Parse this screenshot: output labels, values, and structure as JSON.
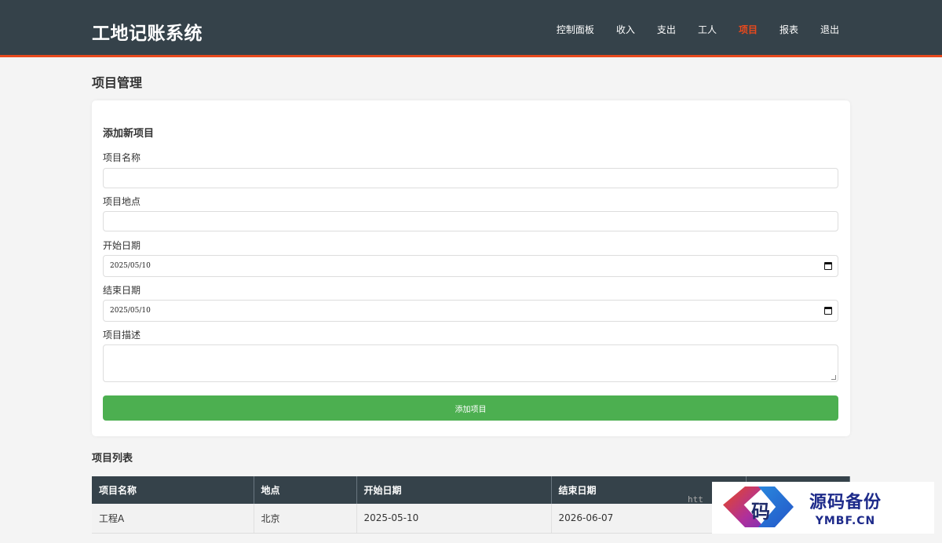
{
  "header": {
    "brand": "工地记账系统",
    "nav": [
      {
        "label": "控制面板",
        "active": false
      },
      {
        "label": "收入",
        "active": false
      },
      {
        "label": "支出",
        "active": false
      },
      {
        "label": "工人",
        "active": false
      },
      {
        "label": "项目",
        "active": true
      },
      {
        "label": "报表",
        "active": false
      },
      {
        "label": "退出",
        "active": false
      }
    ]
  },
  "page_title": "项目管理",
  "form": {
    "title": "添加新项目",
    "name_label": "项目名称",
    "name_value": "",
    "location_label": "项目地点",
    "location_value": "",
    "start_label": "开始日期",
    "start_value": "2025/05/10",
    "end_label": "结束日期",
    "end_value": "2025/05/10",
    "desc_label": "项目描述",
    "desc_value": "",
    "submit_label": "添加项目"
  },
  "list": {
    "title": "项目列表",
    "columns": [
      "项目名称",
      "地点",
      "开始日期",
      "结束日期",
      ""
    ],
    "rows": [
      [
        "工程A",
        "北京",
        "2025-05-10",
        "2026-06-07",
        ""
      ]
    ]
  },
  "watermark": {
    "url_fragment": "htt",
    "logo_char": "码",
    "cn": "源码备份",
    "en": "YMBF.CN"
  },
  "colors": {
    "header_bg": "#35424a",
    "accent": "#e8491d",
    "submit_bg": "#4caf50"
  }
}
